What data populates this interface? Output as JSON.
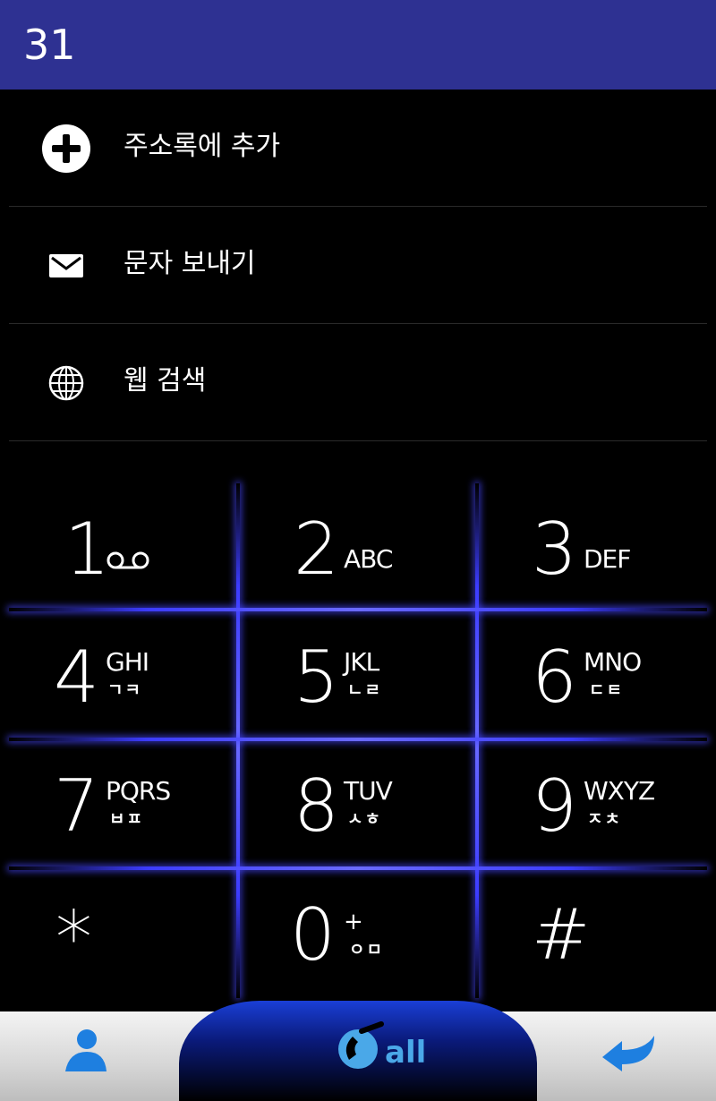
{
  "header": {
    "number": "31"
  },
  "menu": {
    "items": [
      {
        "label": "주소록에 추가",
        "icon": "add-circle-icon"
      },
      {
        "label": "문자 보내기",
        "icon": "envelope-icon"
      },
      {
        "label": "웹 검색",
        "icon": "globe-icon"
      }
    ]
  },
  "keypad": {
    "keys": [
      {
        "digit": "1",
        "letters": "",
        "korean": "",
        "icon": "voicemail-icon"
      },
      {
        "digit": "2",
        "letters": "ABC",
        "korean": ""
      },
      {
        "digit": "3",
        "letters": "DEF",
        "korean": ""
      },
      {
        "digit": "4",
        "letters": "GHI",
        "korean": "ㄱㅋ"
      },
      {
        "digit": "5",
        "letters": "JKL",
        "korean": "ㄴㄹ"
      },
      {
        "digit": "6",
        "letters": "MNO",
        "korean": "ㄷㅌ"
      },
      {
        "digit": "7",
        "letters": "PQRS",
        "korean": "ㅂㅍ"
      },
      {
        "digit": "8",
        "letters": "TUV",
        "korean": "ㅅㅎ"
      },
      {
        "digit": "9",
        "letters": "WXYZ",
        "korean": "ㅈㅊ"
      },
      {
        "digit": "*",
        "letters": "",
        "korean": ""
      },
      {
        "digit": "0",
        "letters": "+",
        "korean": "ㅇㅁ"
      },
      {
        "digit": "#",
        "letters": "",
        "korean": ""
      }
    ]
  },
  "bottombar": {
    "contacts_icon": "person-icon",
    "call_label": "all",
    "call_icon": "phone-handset-icon",
    "back_icon": "back-arrow-icon"
  },
  "colors": {
    "header": "#2e3192",
    "glow": "#3c3cff",
    "call_text": "#4aa8e8"
  }
}
